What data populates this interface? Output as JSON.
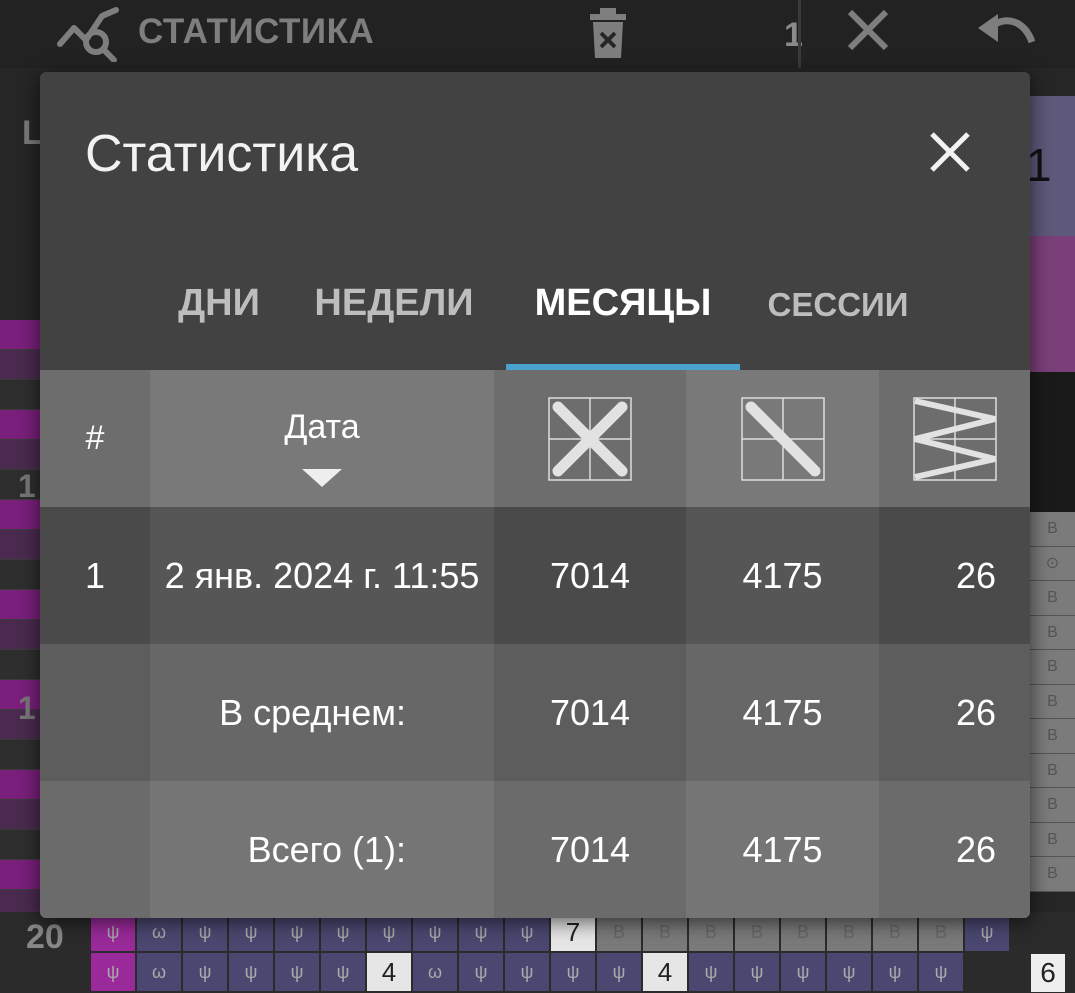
{
  "app_bar": {
    "title": "СТАТИСТИКА",
    "side_number": "1",
    "icons": [
      "chart-search-icon",
      "delete-icon",
      "close-icon",
      "undo-icon"
    ]
  },
  "background": {
    "left_label": "L",
    "right_number": "1",
    "row_numbers": [
      "1",
      "1",
      "20"
    ],
    "grid_symbol": "ψ",
    "grid_b": "B",
    "bottom_counts": [
      "7",
      "4",
      "4",
      "6"
    ]
  },
  "dialog": {
    "title": "Статистика",
    "close_icon": "close-icon"
  },
  "tabs": [
    {
      "label": "ДНИ",
      "active": false
    },
    {
      "label": "НЕДЕЛИ",
      "active": false
    },
    {
      "label": "МЕСЯЦЫ",
      "active": true
    },
    {
      "label": "СЕССИИ",
      "active": false
    }
  ],
  "accent_color": "#4aa3cf",
  "table": {
    "headers": {
      "num": "#",
      "date": "Дата",
      "sort": "descending",
      "col_icons": [
        "cross-stitch-icon",
        "half-stitch-icon",
        "zigzag-stitch-icon"
      ]
    },
    "rows": [
      {
        "num": "1",
        "date": "2 янв. 2024 г. 11:55",
        "v1": "7014",
        "v2": "4175",
        "v3": "26"
      },
      {
        "num": "",
        "date": "В среднем:",
        "v1": "7014",
        "v2": "4175",
        "v3": "26"
      },
      {
        "num": "",
        "date": "Всего (1):",
        "v1": "7014",
        "v2": "4175",
        "v3": "26"
      }
    ]
  }
}
